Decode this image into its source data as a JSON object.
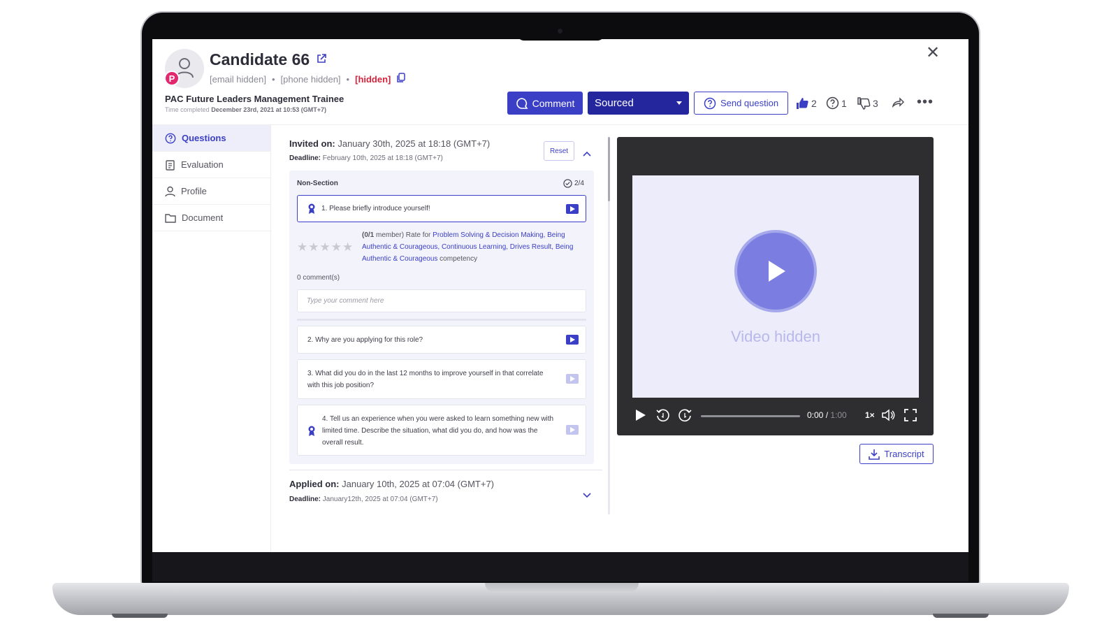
{
  "candidate": {
    "name": "Candidate 66",
    "avatar_badge": "P",
    "email": "[email hidden]",
    "phone": "[phone hidden]",
    "hidden_tag": "[hidden]",
    "separator": "•"
  },
  "job": {
    "title": "PAC Future Leaders Management Trainee",
    "time_completed_label": "Time completed",
    "time_completed_value": "December 23rd, 2021 at 10:53 (GMT+7)"
  },
  "toolbar": {
    "comment_label": "Comment",
    "status_value": "Sourced",
    "send_question_label": "Send question",
    "thumbs_up_count": "2",
    "question_count": "1",
    "thumbs_down_count": "3",
    "close_glyph": "✕",
    "more_glyph": "•••"
  },
  "sidebar": {
    "items": [
      {
        "label": "Questions",
        "icon": "question-circle-icon"
      },
      {
        "label": "Evaluation",
        "icon": "clipboard-icon"
      },
      {
        "label": "Profile",
        "icon": "user-icon"
      },
      {
        "label": "Document",
        "icon": "folder-icon"
      }
    ]
  },
  "invitation": {
    "invited_label": "Invited on:",
    "invited_value": "January 30th, 2025 at 18:18 (GMT+7)",
    "deadline_label": "Deadline:",
    "deadline_value": "February 10th, 2025 at 18:18 (GMT+7)",
    "reset_label": "Reset"
  },
  "section": {
    "name": "Non-Section",
    "progress": "2/4",
    "questions": [
      {
        "text": "1. Please briefly introduce yourself!"
      },
      {
        "text": "2. Why are you applying for this role?"
      },
      {
        "text": "3. What did you do in the last 12 months to improve yourself in that correlate with this job position?"
      },
      {
        "text": "4. Tell us an experience when you were asked to learn something new with limited time. Describe the situation, what did you do, and how was the overall result."
      }
    ],
    "rating": {
      "stars": "★★★★★",
      "member_count": "(0/1",
      "member_suffix": " member) Rate for ",
      "competencies": "Problem Solving & Decision Making, Being Authentic & Courageous, Continuous Learning, Drives Result, Being Authentic & Courageous",
      "suffix": " competency"
    },
    "comment_count": "0 comment(s)",
    "comment_placeholder": "Type your comment here"
  },
  "application": {
    "applied_label": "Applied on:",
    "applied_value": "January 10th, 2025 at 07:04 (GMT+7)",
    "deadline_label": "Deadline:",
    "deadline_value": "January12th, 2025 at 07:04 (GMT+7)"
  },
  "video": {
    "hidden_text": "Video hidden",
    "current_time": "0:00",
    "time_sep": " / ",
    "duration": "1:00",
    "progress": 0,
    "speed": "1×"
  },
  "transcript_label": "Transcript",
  "colors": {
    "brand": "#3b3fc6",
    "brand_dark": "#24269e",
    "alert": "#d8223a",
    "badge": "#e0296f"
  }
}
